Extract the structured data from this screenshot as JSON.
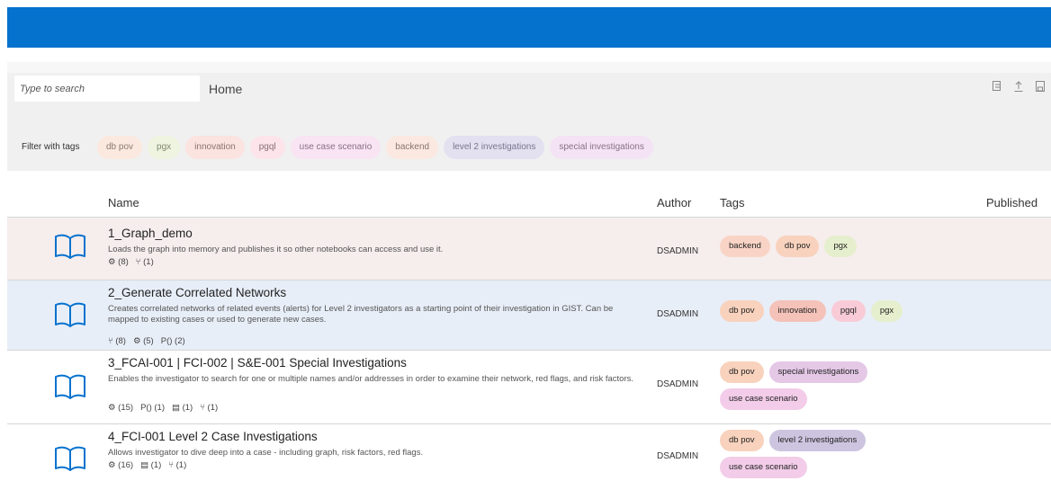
{
  "search": {
    "placeholder": "Type to search"
  },
  "breadcrumb": "Home",
  "filter": {
    "label": "Filter with tags",
    "tags": [
      {
        "label": "db pov",
        "bg": "#fbe9df",
        "fg": "#8a7a70"
      },
      {
        "label": "pgx",
        "bg": "#eef4e0",
        "fg": "#7f8a70"
      },
      {
        "label": "innovation",
        "bg": "#fbe3e0",
        "fg": "#8a7370"
      },
      {
        "label": "pgql",
        "bg": "#fce4ea",
        "fg": "#8a7077"
      },
      {
        "label": "use case scenario",
        "bg": "#f8e4f2",
        "fg": "#8a7085"
      },
      {
        "label": "backend",
        "bg": "#fbe8e0",
        "fg": "#8a7570"
      },
      {
        "label": "level 2 investigations",
        "bg": "#e3e0f0",
        "fg": "#7a7590"
      },
      {
        "label": "special investigations",
        "bg": "#f4e3f4",
        "fg": "#8a7088"
      }
    ]
  },
  "columns": {
    "name": "Name",
    "author": "Author",
    "tags": "Tags",
    "published": "Published"
  },
  "rows": [
    {
      "title": "1_Graph_demo",
      "description": "Loads the graph into memory and publishes it so other notebooks can access and use it.",
      "meta": [
        "⚙ (8)",
        "⑂ (1)"
      ],
      "author": "DSADMIN",
      "bg": "#f6eded",
      "tags": [
        {
          "label": "backend",
          "bg": "#f9d4c6"
        },
        {
          "label": "db pov",
          "bg": "#f8d2bd"
        },
        {
          "label": "pgx",
          "bg": "#e6efcd"
        }
      ]
    },
    {
      "title": "2_Generate Correlated Networks",
      "description": "Creates correlated networks of related events (alerts) for Level 2 investigators as a starting point of their investigation in GIST. Can be mapped to existing cases or used to generate new cases.",
      "meta": [
        "⑂ (8)",
        "⚙ (5)",
        "P() (2)"
      ],
      "author": "DSADMIN",
      "bg": "#e8eef8",
      "tags": [
        {
          "label": "db pov",
          "bg": "#f8d2bd"
        },
        {
          "label": "innovation",
          "bg": "#f4c2b8"
        },
        {
          "label": "pgql",
          "bg": "#f8cbd6"
        },
        {
          "label": "pgx",
          "bg": "#e6efcd"
        }
      ]
    },
    {
      "title": "3_FCAI-001 | FCI-002 | S&E-001 Special Investigations",
      "description": "Enables the investigator to search for one or multiple names and/or addresses in order to examine their network, red flags, and risk factors.",
      "meta": [
        "⚙ (15)",
        "P() (1)",
        "▤ (1)",
        "⑂ (1)"
      ],
      "author": "DSADMIN",
      "bg": "#ffffff",
      "tags": [
        {
          "label": "db pov",
          "bg": "#f8d2bd"
        },
        {
          "label": "special investigations",
          "bg": "#e4c8e6"
        },
        {
          "label": "use case scenario",
          "bg": "#f2cce8"
        }
      ]
    },
    {
      "title": "4_FCI-001 Level 2 Case Investigations",
      "description": "Allows investigator to dive deep into a case - including graph, risk factors, red flags.",
      "meta": [
        "⚙ (16)",
        "▤ (1)",
        "⑂ (1)"
      ],
      "author": "DSADMIN",
      "bg": "#ffffff",
      "tags": [
        {
          "label": "db pov",
          "bg": "#f8d2bd"
        },
        {
          "label": "level 2 investigations",
          "bg": "#cdc5e0"
        },
        {
          "label": "use case scenario",
          "bg": "#f2cce8"
        }
      ]
    }
  ]
}
